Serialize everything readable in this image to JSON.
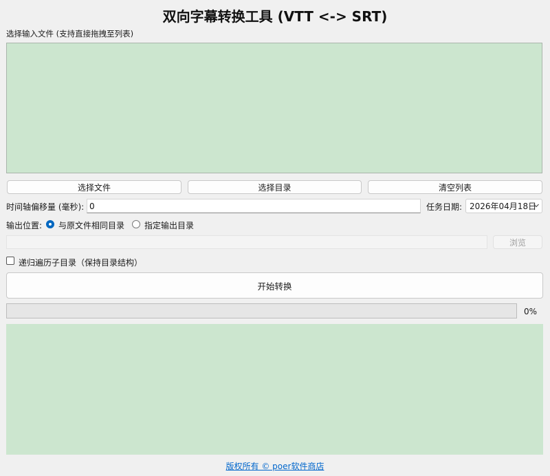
{
  "window": {
    "title": "双向字幕转换工具 (VTT <-> SRT)"
  },
  "input": {
    "label": "选择输入文件 (支持直接拖拽至列表)",
    "files": []
  },
  "buttons": {
    "select_file": "选择文件",
    "select_dir": "选择目录",
    "clear_list": "清空列表",
    "browse": "浏览",
    "start": "开始转换"
  },
  "offset": {
    "label": "时间轴偏移量 (毫秒):",
    "value": "0"
  },
  "task_date": {
    "label": "任务日期:",
    "value": "2026年04月18日"
  },
  "output": {
    "label": "输出位置:",
    "options": [
      "与原文件相同目录",
      "指定输出目录"
    ],
    "selected": "与原文件相同目录",
    "dir_value": ""
  },
  "recursive": {
    "label": "递归遍历子目录（保持目录结构）",
    "checked": false
  },
  "progress": {
    "value": 0,
    "text": "0%"
  },
  "log": {
    "lines": []
  },
  "footer": {
    "text": "版权所有 © poer软件商店"
  },
  "colors": {
    "list_bg": "#cce6cf",
    "accent": "#0067c0",
    "link": "#0066cc"
  }
}
